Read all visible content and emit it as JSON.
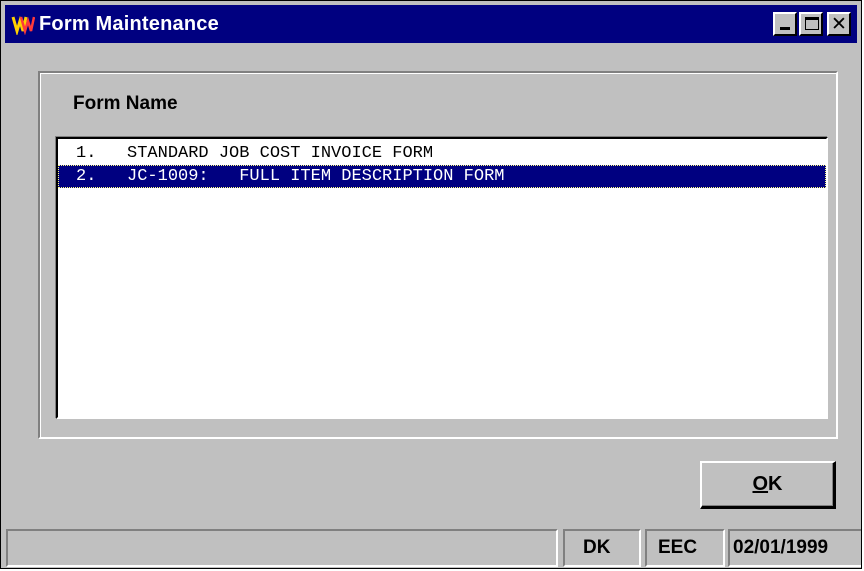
{
  "window": {
    "title": "Form Maintenance",
    "icon": "app-logo-icon"
  },
  "group": {
    "label": "Form Name"
  },
  "forms": [
    {
      "text": "1.   STANDARD JOB COST INVOICE FORM",
      "selected": false
    },
    {
      "text": "2.   JC-1009:   FULL ITEM DESCRIPTION FORM",
      "selected": true
    }
  ],
  "buttons": {
    "ok_mnemonic": "O",
    "ok_rest": "K"
  },
  "statusbar": {
    "message": "",
    "user": "DK",
    "company": "EEC",
    "date": "02/01/1999"
  },
  "colors": {
    "titlebar": "#000080",
    "selection": "#000080",
    "face": "#c0c0c0"
  }
}
